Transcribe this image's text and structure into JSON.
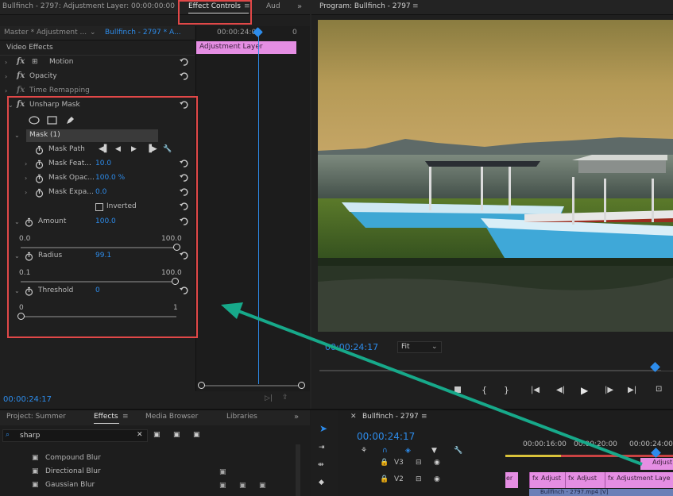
{
  "window": {
    "effect_controls_title": "Bullfinch - 2797: Adjustment Layer: 00:00:00:00",
    "tab_effect_controls": "Effect Controls",
    "tab_audio": "Aud",
    "program_title": "Program: Bullfinch - 2797"
  },
  "effect_controls": {
    "master_label": "Master * Adjustment ...",
    "sequence_label": "Bullfinch - 2797 * A...",
    "timeline_time": "00:00:24:00",
    "timeline_end": "0",
    "clip_label": "Adjustment Layer",
    "section_video_effects": "Video Effects",
    "motion": "Motion",
    "opacity": "Opacity",
    "time_remapping": "Time Remapping",
    "unsharp_mask": "Unsharp Mask",
    "mask_name": "Mask (1)",
    "mask_path": "Mask Path",
    "mask_feather_label": "Mask Feat...",
    "mask_feather_value": "10.0",
    "mask_opacity_label": "Mask Opac...",
    "mask_opacity_value": "100.0 %",
    "mask_expansion_label": "Mask Expa...",
    "mask_expansion_value": "0.0",
    "inverted": "Inverted",
    "amount_label": "Amount",
    "amount_value": "100.0",
    "amount_min": "0.0",
    "amount_max": "100.0",
    "amount_fraction": 1.0,
    "radius_label": "Radius",
    "radius_value": "99.1",
    "radius_min": "0.1",
    "radius_max": "100.0",
    "radius_fraction": 0.99,
    "threshold_label": "Threshold",
    "threshold_value": "0",
    "threshold_min": "0",
    "threshold_max": "1",
    "threshold_fraction": 0.0,
    "current_time": "00:00:24:17"
  },
  "program": {
    "timecode": "00:00:24:17",
    "zoom": "Fit"
  },
  "project": {
    "tab_project": "Project: Summer",
    "tab_effects": "Effects",
    "tab_media_browser": "Media Browser",
    "tab_libraries": "Libraries",
    "search_value": "sharp",
    "items": [
      "Compound Blur",
      "Directional Blur",
      "Gaussian Blur"
    ]
  },
  "timeline": {
    "sequence_name": "Bullfinch - 2797",
    "timecode": "00:00:24:17",
    "ruler_1": "00:00:16:00",
    "ruler_2": "00:00:20:00",
    "ruler_3": "00:00:24:00",
    "track_v3": "V3",
    "track_v2": "V2",
    "clip_adjust_1": "Adjust",
    "clip_adjust_2": "Adjust",
    "clip_adjust_3": "Adjustment Laye",
    "clip_adjust_top": "Adjust",
    "clip_fx_stub": "er",
    "clip_bottom": "Bullfinch - 2797.mp4 [V]"
  },
  "colors": {
    "accent_blue": "#2d8ceb",
    "highlight_red": "#e14848",
    "clip_pink": "#e58ee3",
    "arrow_teal": "#17a98a"
  }
}
